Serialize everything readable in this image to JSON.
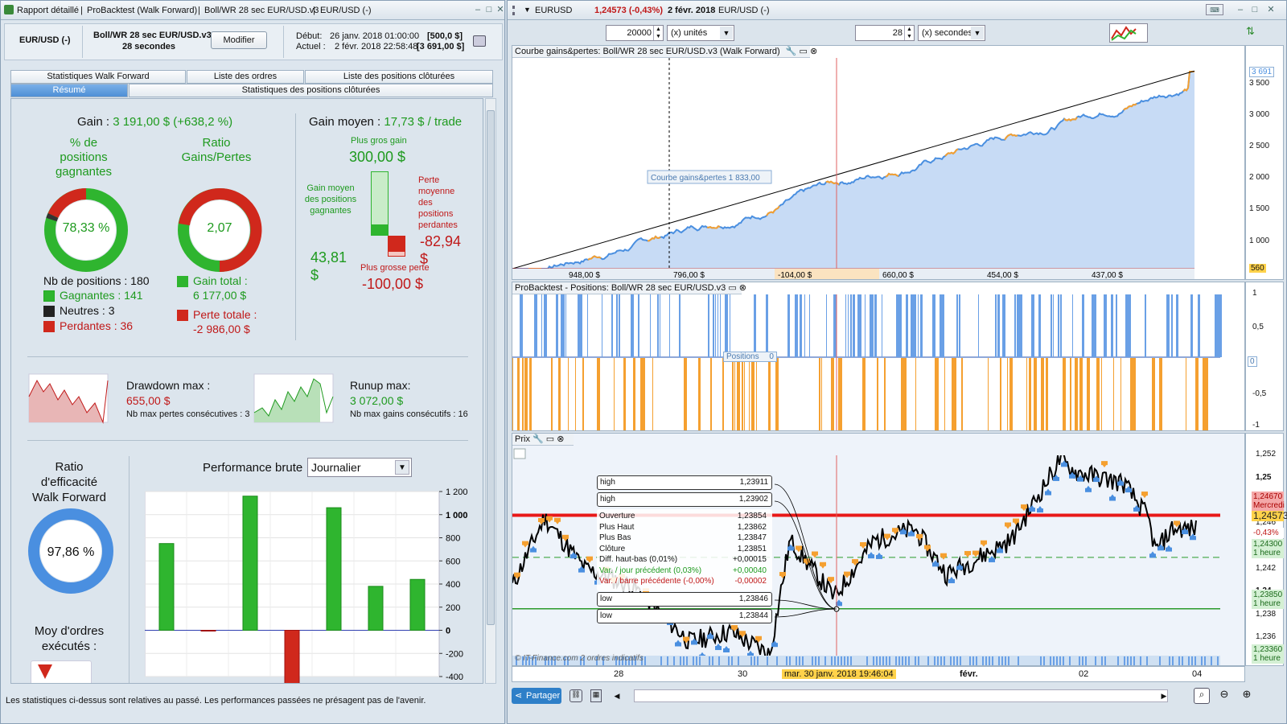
{
  "left": {
    "titlebar": {
      "t1": "Rapport détaillé",
      "t2": "ProBacktest (Walk Forward)",
      "t3": "Boll/WR 28 sec EUR/USD.v3",
      "t4": "EUR/USD (-)"
    },
    "header": {
      "instrument": "EUR/USD (-)",
      "strategy": "Boll/WR 28 sec EUR/USD.v3",
      "period": "28 secondes",
      "modify": "Modifier",
      "start_label": "Début:",
      "start_date": "26 janv. 2018 01:00:00",
      "start_val": "[500,0 $]",
      "current_label": "Actuel :",
      "current_date": "2 févr. 2018 22:58:48",
      "current_val": "[3 691,00 $]"
    },
    "tabs": {
      "row1": [
        "Statistiques Walk Forward",
        "Liste des ordres",
        "Liste des positions clôturées"
      ],
      "row2": [
        "Résumé",
        "Statistiques des positions clôturées"
      ]
    },
    "stats": {
      "gain_label": "Gain :",
      "gain_val": "3 191,00 $ (+638,2 %)",
      "pct_win_label": "% de positions gagnantes",
      "pct_win_val": "78,33 %",
      "ratio_label": "Ratio Gains/Pertes",
      "ratio_val": "2,07",
      "nb_label": "Nb de positions : 180",
      "winners": "Gagnantes : 141",
      "neutrals": "Neutres : 3",
      "losers": "Perdantes : 36",
      "gain_total_label": "Gain total :",
      "gain_total_val": "6 177,00 $",
      "perte_totale_label": "Perte totale :",
      "perte_totale_val": "-2 986,00 $",
      "gain_moyen_label": "Gain moyen :",
      "gain_moyen_val": "17,73 $ / trade",
      "plus_gros_gain_label": "Plus gros gain",
      "plus_gros_gain_val": "300,00 $",
      "gain_moyen_pos_label": "Gain moyen des positions gagnantes",
      "gain_moyen_pos_val": "43,81 $",
      "perte_moyenne_label": "Perte moyenne des positions perdantes",
      "perte_moyenne_val": "-82,94 $",
      "plus_grosse_perte_label": "Plus grosse perte",
      "plus_grosse_perte_val": "-100,00 $",
      "drawdown_label": "Drawdown max :",
      "drawdown_val": "655,00 $",
      "drawdown_sub": "Nb max pertes consécutives : 3",
      "runup_label": "Runup max:",
      "runup_val": "3 072,00 $",
      "runup_sub": "Nb max gains consécutifs : 16",
      "wf_label": "Ratio d'efficacité Walk Forward",
      "wf_val": "97,86 %",
      "moy_ordres_label": "Moy d'ordres exécutés :",
      "perf_label": "Performance brute",
      "perf_select": "Journalier"
    },
    "perf_chart": {
      "values": [
        750,
        -5,
        1160,
        -470,
        1060,
        380,
        440
      ],
      "ticks": [
        "1 200",
        "1 000",
        "800",
        "600",
        "400",
        "200",
        "0",
        "-200",
        "-400"
      ]
    },
    "footer": "Les statistiques ci-dessus sont relatives au passé. Les performances passées ne présagent pas de l'avenir."
  },
  "right": {
    "titlebar": {
      "symbol": "EURUSD",
      "change": "1,24573 (-0,43%)",
      "date": "2 févr. 2018",
      "instrument": "EUR/USD (-)"
    },
    "toolbar": {
      "units_val": "20000",
      "units_sel": "(x) unités",
      "seconds_val": "28",
      "seconds_sel": "(x) secondes"
    },
    "equity": {
      "title": "Courbe gains&pertes: Boll/WR 28 sec EUR/USD.v3 (Walk Forward)",
      "label": "Courbe gains&pertes",
      "label_val": "1 833,00",
      "ticks": [
        "3 691",
        "3 500",
        "3 000",
        "2 500",
        "2 000",
        "1 500",
        "1 000",
        "560"
      ],
      "periods": [
        "948,00 $",
        "796,00 $",
        "-104,00 $",
        "660,00 $",
        "454,00 $",
        "437,00 $"
      ]
    },
    "positions": {
      "title": "ProBacktest - Positions: Boll/WR 28 sec EUR/USD.v3",
      "label": "Positions",
      "label_val": "0",
      "ticks": [
        "1",
        "0,5",
        "0",
        "-0,5",
        "-1"
      ]
    },
    "price": {
      "title": "Prix",
      "tip_high1": "high",
      "tip_high1_val": "1,23911",
      "tip_high2": "high",
      "tip_high2_val": "1,23902",
      "ohlc": [
        [
          "Ouverture",
          "1,23854"
        ],
        [
          "Plus Haut",
          "1,23862"
        ],
        [
          "Plus Bas",
          "1,23847"
        ],
        [
          "Clôture",
          "1,23851"
        ],
        [
          "Diff. haut-bas (0,01%)",
          "+0,00015"
        ],
        [
          "Var. / jour précédent (0,03%)",
          "+0,00040"
        ],
        [
          "Var. / barre précédente (-0,00%)",
          "-0,00002"
        ]
      ],
      "tip_low1": "low",
      "tip_low1_val": "1,23846",
      "tip_low2": "low",
      "tip_low2_val": "1,23844",
      "ticks": [
        "1,252",
        "1,25",
        "1,248",
        "1,246",
        "1,244",
        "1,242",
        "1,24",
        "1,238",
        "1,236",
        "1,234"
      ],
      "tag1": "1,24670",
      "tag1b": "Mercredi",
      "tag2": "1,24573",
      "tag3": "-0,43%",
      "tag4": "1,24300",
      "tag4b": "1 heure",
      "tag5": "1,23850",
      "tag5b": "1 heure",
      "tag6": "1,23360",
      "tag6b": "1 heure",
      "watermark": "© IT-Finance.com 2 ordres indicatifs"
    },
    "xaxis": {
      "labels": [
        "28",
        "30",
        "févr.",
        "02",
        "04"
      ],
      "cursor_date": "mar. 30 janv. 2018 19:46:04"
    },
    "bottom": {
      "share": "Partager"
    }
  },
  "colors": {
    "green": "#2fb52f",
    "red": "#d0281c",
    "blue": "#4a8fe0",
    "orange": "#f5a030"
  }
}
